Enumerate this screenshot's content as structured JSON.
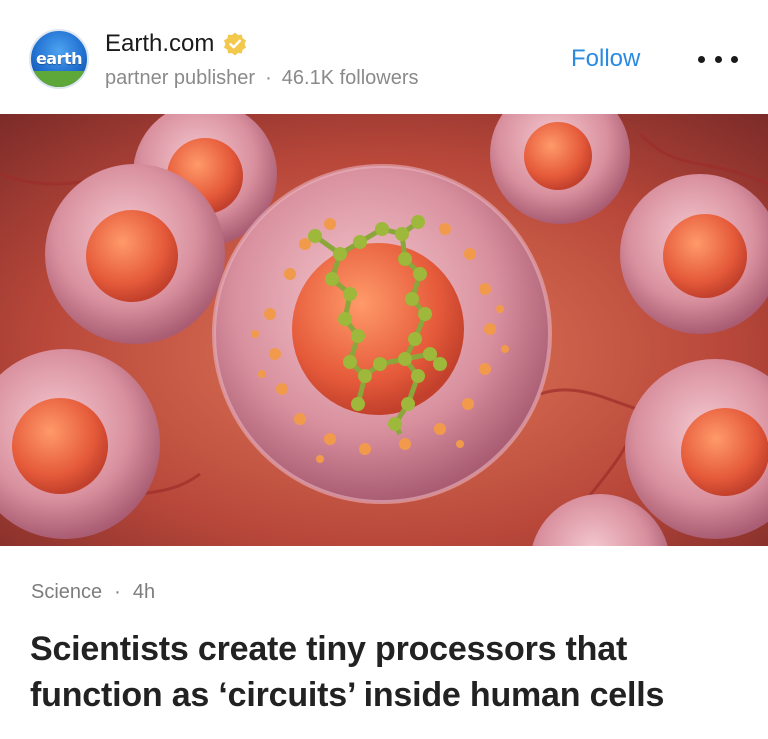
{
  "publisher": {
    "logo_text": "earth",
    "name": "Earth.com",
    "label": "partner publisher",
    "separator": "·",
    "followers": "46.1K followers",
    "verified_icon": "verified-badge-icon",
    "colors": {
      "verified": "#f2c94c",
      "follow": "#2a8be0"
    }
  },
  "actions": {
    "follow_label": "Follow",
    "more_icon": "more-horizontal-icon"
  },
  "article": {
    "category": "Science",
    "separator": "·",
    "age": "4h",
    "headline": "Scientists create tiny processors that function as ‘circuits’ inside human cells"
  }
}
